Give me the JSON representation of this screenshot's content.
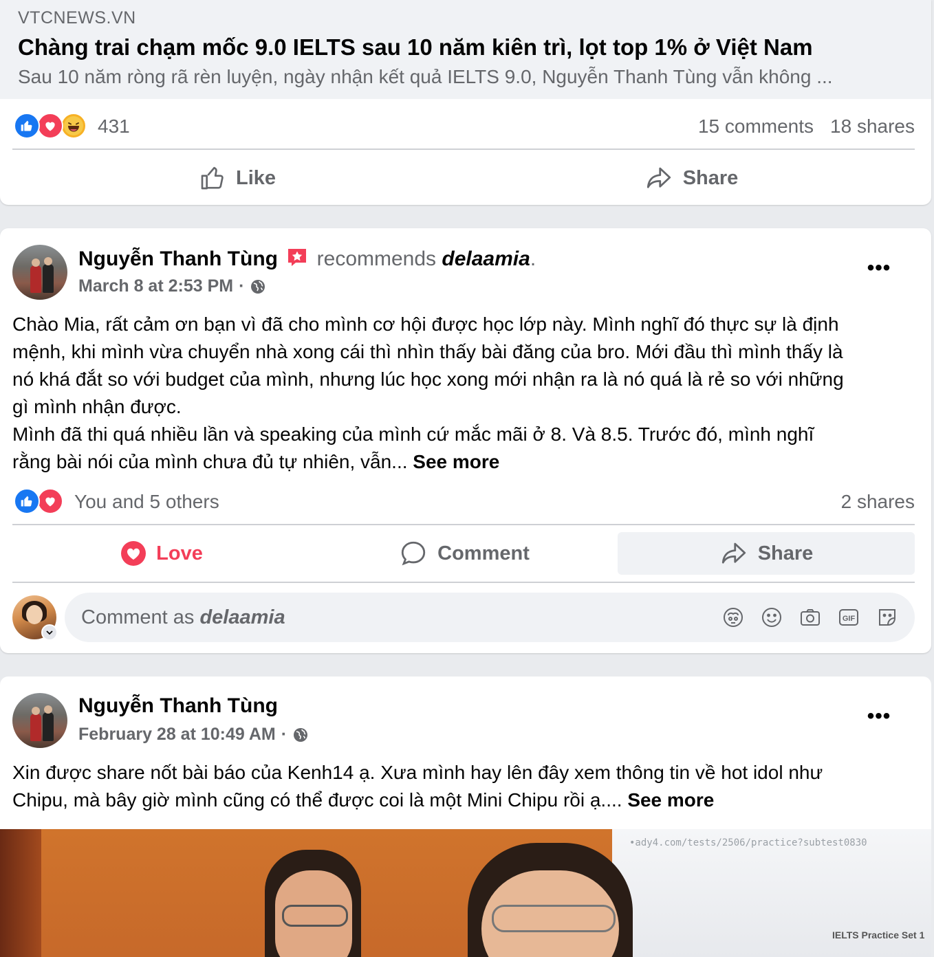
{
  "shared_post": {
    "link": {
      "domain": "VTCNEWS.VN",
      "title": "Chàng trai chạm mốc 9.0 IELTS sau 10 năm kiên trì, lọt top 1% ở Việt Nam",
      "description": "Sau 10 năm ròng rã rèn luyện, ngày nhận kết quả IELTS 9.0, Nguyễn Thanh Tùng vẫn không ..."
    },
    "reaction_count": "431",
    "comments": "15 comments",
    "shares": "18 shares",
    "actions": {
      "like": "Like",
      "share": "Share"
    }
  },
  "post1": {
    "author": "Nguyễn Thanh Tùng",
    "recommends": "recommends",
    "page": "delaamia",
    "period": ".",
    "time": "March 8 at 2:53 PM",
    "dot": "·",
    "more": "•••",
    "text_lines": [
      "Chào Mia, rất cảm ơn bạn vì đã cho mình cơ hội được học lớp này. Mình nghĩ đó thực sự là định",
      "mệnh, khi mình vừa chuyển nhà xong cái thì nhìn thấy bài đăng của bro. Mới đầu thì mình thấy là",
      "nó khá đắt so với budget của mình, nhưng lúc học xong mới nhận ra là nó quá là rẻ so với những",
      "gì mình nhận được.",
      "Mình đã thi quá nhiều lần và speaking của mình cứ mắc mãi ở 8. Và 8.5. Trước đó, mình nghĩ",
      "rằng bài nói của mình chưa đủ tự nhiên, vẫn... "
    ],
    "see_more": "See more",
    "reactions_text": "You and 5 others",
    "shares": "2 shares",
    "actions": {
      "love": "Love",
      "comment": "Comment",
      "share": "Share"
    },
    "comment_prefix": "Comment as ",
    "comment_as": "delaamia",
    "gif_label": "GIF"
  },
  "post2": {
    "author": "Nguyễn Thanh Tùng",
    "time": "February 28 at 10:49 AM",
    "dot": "·",
    "more": "•••",
    "text_lines": [
      "Xin được share nốt bài báo của Kenh14 ạ. Xưa mình hay lên đây xem thông tin về hot idol như",
      "Chipu, mà bây giờ mình cũng có thể được coi là một Mini Chipu rồi ạ.... "
    ],
    "see_more": "See more",
    "photo": {
      "url_text": "•ady4.com/tests/2506/practice?subtest0830",
      "caption": "IELTS Practice Set 1"
    }
  },
  "colors": {
    "like_blue": "#1877f2",
    "love_red": "#f33e58",
    "haha_yellow": "#f7b125",
    "secondary_text": "#65676b",
    "divider": "#ced0d4"
  }
}
